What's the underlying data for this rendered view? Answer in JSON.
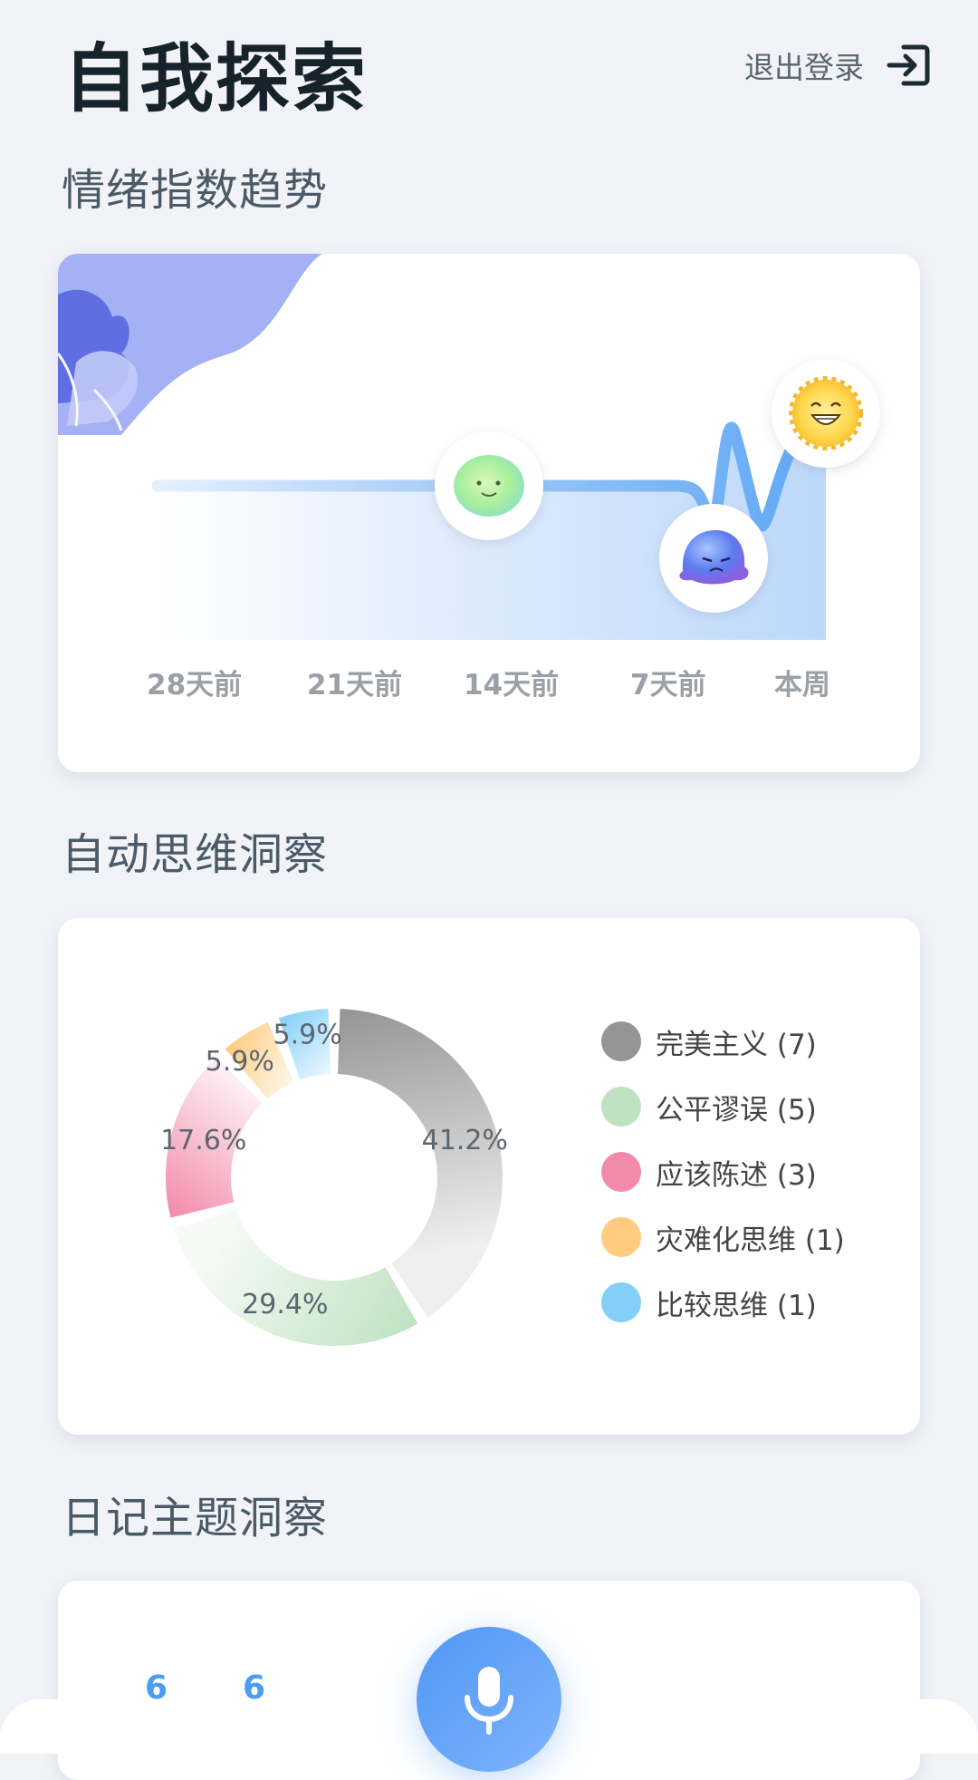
{
  "header": {
    "title": "自我探索",
    "logout_label": "退出登录"
  },
  "sections": {
    "mood_trend": "情绪指数趋势",
    "auto_thought": "自动思维洞察",
    "diary_topic": "日记主题洞察"
  },
  "mood_chart": {
    "x_labels": [
      "28天前",
      "21天前",
      "14天前",
      "7天前",
      "本周"
    ]
  },
  "chart_data": {
    "type": "pie",
    "categories": [
      "完美主义",
      "公平谬误",
      "应该陈述",
      "灾难化思维",
      "比较思维"
    ],
    "values": [
      7,
      5,
      3,
      1,
      1
    ],
    "percent_labels": [
      "41.2%",
      "29.4%",
      "17.6%",
      "5.9%",
      "5.9%"
    ],
    "legend_labels": [
      "完美主义 (7)",
      "公平谬误 (5)",
      "应该陈述 (3)",
      "灾难化思维 (1)",
      "比较思维 (1)"
    ],
    "colors": [
      "#959595",
      "#bfe2c2",
      "#f28bab",
      "#ffcc80",
      "#84cff8"
    ],
    "legend": "right"
  },
  "diary_stats": {
    "stat1": "6",
    "stat2": "6"
  },
  "icons": {
    "logout": "logout-icon",
    "mic": "microphone-icon"
  }
}
